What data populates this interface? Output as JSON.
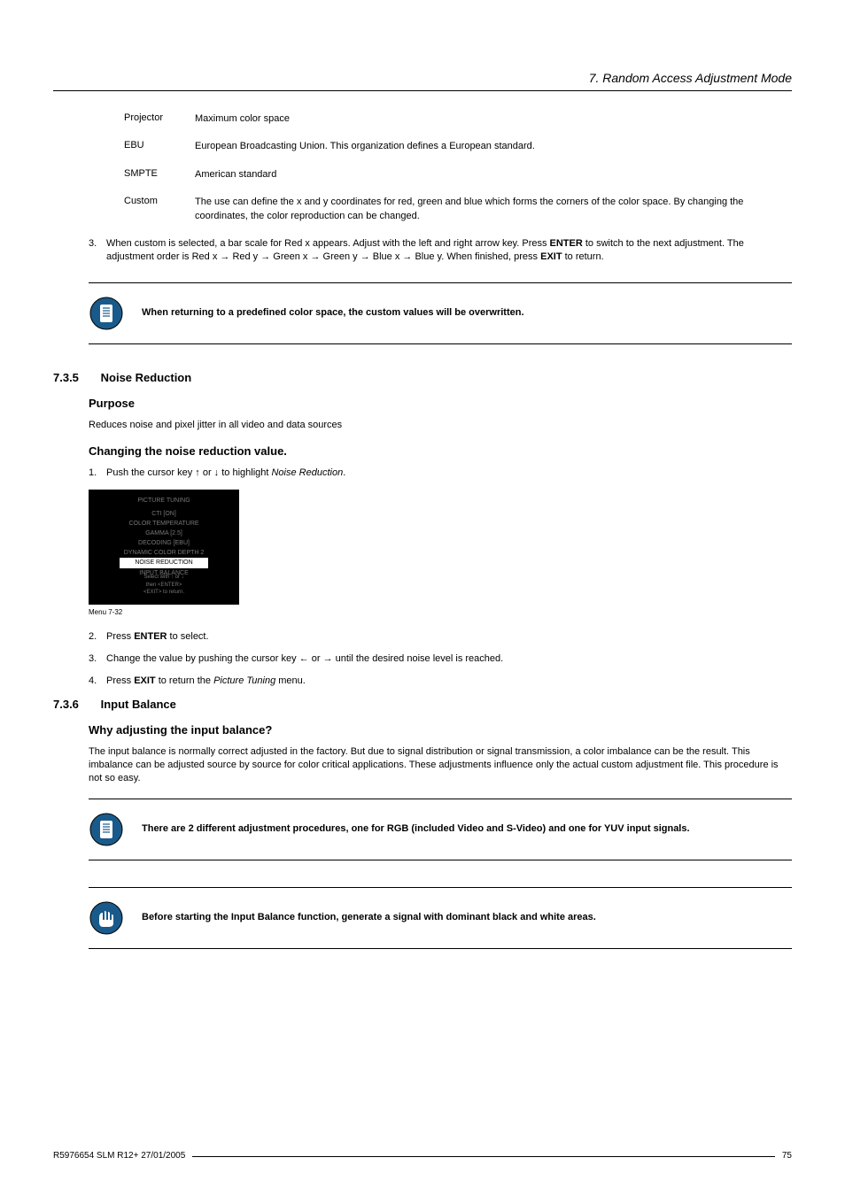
{
  "header": {
    "title": "7. Random Access Adjustment Mode"
  },
  "definitions": [
    {
      "term": "Projector",
      "desc": "Maximum color space"
    },
    {
      "term": "EBU",
      "desc": "European Broadcasting Union. This organization defines a European standard."
    },
    {
      "term": "SMPTE",
      "desc": "American standard"
    },
    {
      "term": "Custom",
      "desc": "The use can define the x and y coordinates for red, green and blue which forms the corners of the color space. By changing the coordinates, the color reproduction can be changed."
    }
  ],
  "step3": {
    "num": "3.",
    "text_before": "When custom is selected, a bar scale for Red x appears. Adjust with the left and right arrow key. Press ",
    "enter": "ENTER",
    "text_mid": " to switch to the next adjustment. The adjustment order is Red x → Red y → Green x → Green y → Blue x → Blue y. When finished, press ",
    "exit": "EXIT",
    "text_end": " to return."
  },
  "note1": "When returning to a predefined color space, the custom values will be overwritten.",
  "section_735": {
    "num": "7.3.5",
    "title": "Noise Reduction"
  },
  "purpose": {
    "heading": "Purpose",
    "text": "Reduces noise and pixel jitter in all video and data sources"
  },
  "changing": {
    "heading": "Changing the noise reduction value.",
    "step1_num": "1.",
    "step1_before": "Push the cursor key ↑ or ↓ to highlight ",
    "step1_italic": "Noise Reduction",
    "step1_after": "."
  },
  "menu": {
    "title": "PICTURE TUNING",
    "items": [
      "CTI [ON]",
      "COLOR TEMPERATURE",
      "GAMMA [2.5]",
      "DECODING [EBU]",
      "DYNAMIC COLOR DEPTH 2"
    ],
    "highlighted": "NOISE REDUCTION",
    "after": "INPUT BALANCE",
    "footer1": "Select with ↑ or ↓",
    "footer2": "then <ENTER>",
    "footer3": "<EXIT> to return.",
    "caption": "Menu 7-32"
  },
  "steps_after": [
    {
      "num": "2.",
      "before": "Press ",
      "bold": "ENTER",
      "after": " to select."
    },
    {
      "num": "3.",
      "before": "Change the value by pushing the cursor key ← or → until the desired noise level is reached.",
      "bold": "",
      "after": ""
    },
    {
      "num": "4.",
      "before": "Press ",
      "bold": "EXIT",
      "after_before": " to return the ",
      "italic": "Picture Tuning",
      "after": " menu."
    }
  ],
  "section_736": {
    "num": "7.3.6",
    "title": "Input Balance"
  },
  "why": {
    "heading": "Why adjusting the input balance?",
    "text": "The input balance is normally correct adjusted in the factory. But due to signal distribution or signal transmission, a color imbalance can be the result. This imbalance can be adjusted source by source for color critical applications. These adjustments influence only the actual custom adjustment file. This procedure is not so easy."
  },
  "note2": "There are 2 different adjustment procedures, one for RGB (included Video and S-Video) and one for YUV input signals.",
  "note3": "Before starting the Input Balance function, generate a signal with dominant black and white areas.",
  "footer": {
    "left": "R5976654 SLM R12+ 27/01/2005",
    "right": "75"
  }
}
